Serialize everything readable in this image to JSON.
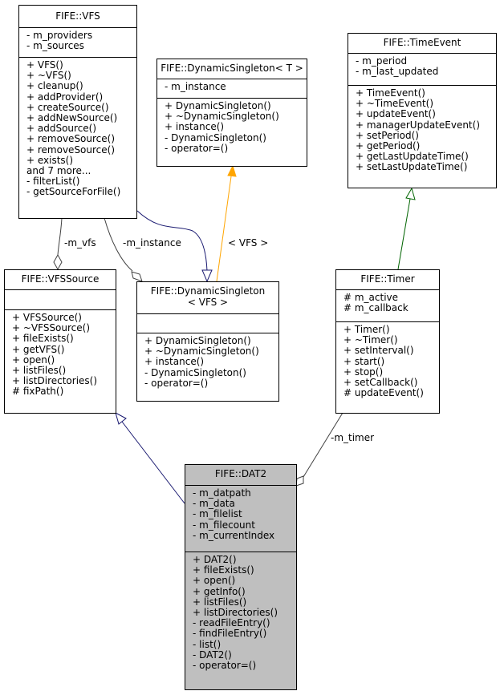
{
  "diagram": {
    "type": "uml-class-collaboration",
    "classes": {
      "vfs": {
        "name": "FIFE::VFS",
        "attributes": [
          "- m_providers",
          "- m_sources"
        ],
        "methods": [
          "+ VFS()",
          "+ ~VFS()",
          "+ cleanup()",
          "+ addProvider()",
          "+ createSource()",
          "+ addNewSource()",
          "+ addSource()",
          "+ removeSource()",
          "+ removeSource()",
          "+ exists()",
          "and 7 more...",
          "- filterList()",
          "- getSourceForFile()"
        ]
      },
      "dynamic_singleton_t": {
        "name": "FIFE::DynamicSingleton< T >",
        "attributes": [
          "- m_instance"
        ],
        "methods": [
          "+ DynamicSingleton()",
          "+ ~DynamicSingleton()",
          "+ instance()",
          "- DynamicSingleton()",
          "- operator=()"
        ]
      },
      "time_event": {
        "name": "FIFE::TimeEvent",
        "attributes": [
          "- m_period",
          "- m_last_updated"
        ],
        "methods": [
          "+ TimeEvent()",
          "+ ~TimeEvent()",
          "+ updateEvent()",
          "+ managerUpdateEvent()",
          "+ setPeriod()",
          "+ getPeriod()",
          "+ getLastUpdateTime()",
          "+ setLastUpdateTime()"
        ]
      },
      "vfs_source": {
        "name": "FIFE::VFSSource",
        "attributes": [],
        "methods": [
          "+ VFSSource()",
          "+ ~VFSSource()",
          "+ fileExists()",
          "+ getVFS()",
          "+ open()",
          "+ listFiles()",
          "+ listDirectories()",
          "# fixPath()"
        ]
      },
      "dynamic_singleton_vfs": {
        "name_line1": "FIFE::DynamicSingleton",
        "name_line2": "< VFS >",
        "attributes": [],
        "methods": [
          "+ DynamicSingleton()",
          "+ ~DynamicSingleton()",
          "+ instance()",
          "- DynamicSingleton()",
          "- operator=()"
        ]
      },
      "timer": {
        "name": "FIFE::Timer",
        "attributes": [
          "# m_active",
          "# m_callback"
        ],
        "methods": [
          "+ Timer()",
          "+ ~Timer()",
          "+ setInterval()",
          "+ start()",
          "+ stop()",
          "+ setCallback()",
          "# updateEvent()"
        ]
      },
      "dat2": {
        "name": "FIFE::DAT2",
        "attributes": [
          "- m_datpath",
          "- m_data",
          "- m_filelist",
          "- m_filecount",
          "- m_currentIndex"
        ],
        "methods": [
          "+ DAT2()",
          "+ fileExists()",
          "+ open()",
          "+ getInfo()",
          "+ listFiles()",
          "+ listDirectories()",
          "- readFileEntry()",
          "- findFileEntry()",
          "- list()",
          "- DAT2()",
          "- operator=()"
        ]
      }
    },
    "edges": {
      "m_vfs": {
        "label": "-m_vfs",
        "kind": "aggregation",
        "from": "FIFE::VFS",
        "to": "FIFE::VFSSource"
      },
      "m_instance": {
        "label": "-m_instance",
        "kind": "aggregation",
        "from": "FIFE::VFS",
        "to": "FIFE::DynamicSingleton< VFS >"
      },
      "vfs_inherits": {
        "kind": "inheritance",
        "from": "FIFE::VFS",
        "to": "FIFE::DynamicSingleton< VFS >"
      },
      "template_instance": {
        "label": "< VFS >",
        "kind": "template-instantiation",
        "from": "FIFE::DynamicSingleton< VFS >",
        "to": "FIFE::DynamicSingleton< T >"
      },
      "timer_inherits": {
        "kind": "inheritance",
        "from": "FIFE::Timer",
        "to": "FIFE::TimeEvent"
      },
      "dat2_inherits": {
        "kind": "inheritance",
        "from": "FIFE::DAT2",
        "to": "FIFE::VFSSource"
      },
      "m_timer": {
        "label": "-m_timer",
        "kind": "aggregation",
        "from": "FIFE::Timer",
        "to": "FIFE::DAT2"
      }
    },
    "colors": {
      "inheritance_public": "#191970",
      "inheritance_timer": "#006400",
      "template": "#ffa500",
      "usage": "#404040",
      "focus_fill": "#bfbfbf"
    }
  }
}
